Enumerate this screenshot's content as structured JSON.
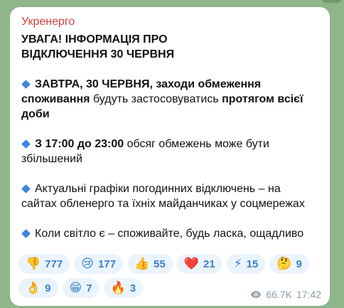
{
  "message": {
    "sender": "Укренерго",
    "title_line1": "УВАГА! ІНФОРМАЦІЯ ПРО",
    "title_line2": "ВІДКЛЮЧЕННЯ 30 ЧЕРВНЯ",
    "p1": {
      "a": "ЗАВТРА, 30 ЧЕРВНЯ, заходи обмеження",
      "b": "споживання",
      "c": " будуть застосовуватись ",
      "d": "протягом всієї",
      "e": "доби"
    },
    "p2": {
      "a": "З 17:00 до 23:00",
      "b": " обсяг обмежень може бути",
      "c": "збільшений"
    },
    "p3": {
      "line1": "Актуальні графіки погодинних відключень – на",
      "line2": "сайтах обленерго та їхніх майданчиках у соцмережах"
    },
    "p4": "Коли світло є – споживайте, будь ласка, ощадливо"
  },
  "reactions": [
    {
      "emoji": "👎",
      "count": "777"
    },
    {
      "emoji": "😢",
      "count": "177"
    },
    {
      "emoji": "👍",
      "count": "55"
    },
    {
      "emoji": "❤️",
      "count": "21"
    },
    {
      "emoji": "⚡",
      "count": "15"
    },
    {
      "emoji": "🤔",
      "count": "9"
    },
    {
      "emoji": "👌",
      "count": "9"
    },
    {
      "emoji": "😁",
      "count": "7"
    },
    {
      "emoji": "🔥",
      "count": "3"
    }
  ],
  "meta": {
    "views": "66.7K",
    "time": "17:42",
    "icon": "eye-icon"
  },
  "colors": {
    "sender": "#d0403b",
    "bullet": "#3f86e0",
    "reaction_bg": "#ebf3fc",
    "reaction_text": "#3a82c8"
  }
}
